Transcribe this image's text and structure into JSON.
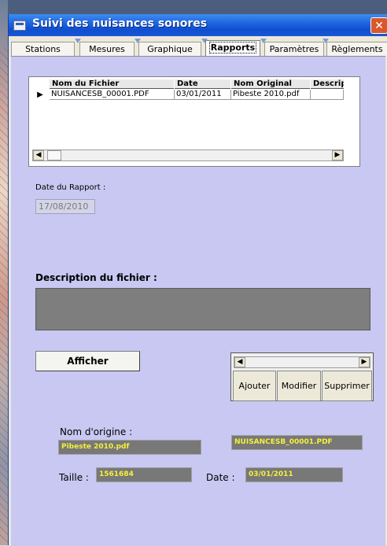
{
  "window": {
    "title": "Suivi des nuisances sonores",
    "close_glyph": "✕"
  },
  "tabs": [
    {
      "label": "Stations"
    },
    {
      "label": "Mesures"
    },
    {
      "label": "Graphique"
    },
    {
      "label": "Rapports",
      "active": true
    },
    {
      "label": "Paramètres"
    },
    {
      "label": "Règlements"
    }
  ],
  "grid": {
    "columns": [
      "Nom du Fichier",
      "Date",
      "Nom Original",
      "Descrip"
    ],
    "rows": [
      {
        "indicator": "▶",
        "cells": [
          "NUISANCESB_00001.PDF",
          "03/01/2011",
          "Pibeste 2010.pdf",
          ""
        ]
      }
    ],
    "scroll_left": "◀",
    "scroll_right": "▶"
  },
  "date_rapport": {
    "label": "Date du Rapport :",
    "value": "17/08/2010"
  },
  "description": {
    "label": "Description du fichier :",
    "value": ""
  },
  "actions": {
    "afficher": "Afficher",
    "ajouter": "Ajouter",
    "modifier": "Modifier",
    "supprimer": "Supprimer",
    "scroll_left": "◀",
    "scroll_right": "▶"
  },
  "info": {
    "nom_origine_label": "Nom d'origine :",
    "nom_origine_value": "Pibeste 2010.pdf",
    "fichier_value": "NUISANCESB_00001.PDF",
    "taille_label": "Taille :",
    "taille_value": "1561684",
    "date_label": "Date :",
    "date_value": "03/01/2011"
  },
  "colors": {
    "panel": "#c8c8f2",
    "titlebar": "#1c62dd",
    "field_text": "#f5f03a",
    "field_bg": "#787878"
  }
}
